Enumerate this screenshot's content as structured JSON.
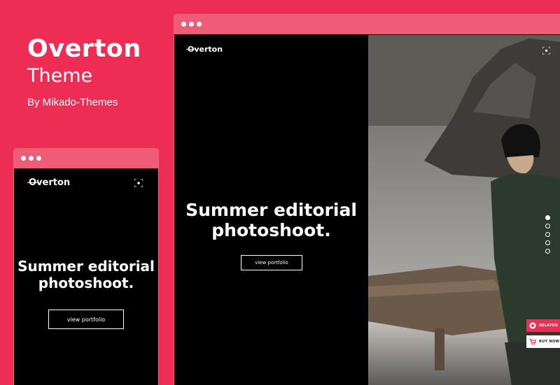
{
  "promo": {
    "title": "Overton",
    "subtitle": "Theme",
    "byline": "By Mikado-Themes"
  },
  "desktop": {
    "logo_initial": "O",
    "logo_rest": "verton",
    "headline_line1": "Summer editorial",
    "headline_line2": "photoshoot.",
    "cta_label": "view portfolio",
    "slides": 5,
    "active_slide": 1,
    "related_label": "RELATED",
    "buy_label": "BUY NOW"
  },
  "mobile": {
    "logo_initial": "O",
    "logo_rest": "verton",
    "headline_line1": "Summer editorial",
    "headline_line2": "photoshoot.",
    "cta_label": "view portfolio"
  },
  "colors": {
    "background": "#ee2d55",
    "window_bar": "#ef5c78",
    "related_button": "#ee2d55"
  },
  "icons": [
    "fullscreen-icon",
    "related-icon",
    "cart-icon"
  ]
}
